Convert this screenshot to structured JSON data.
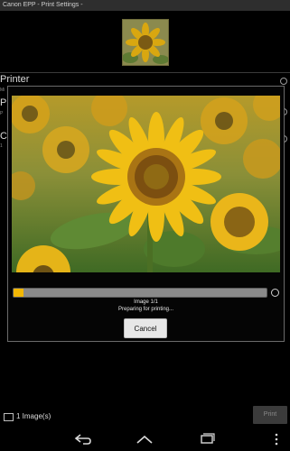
{
  "app": {
    "title": "Canon EPP  - Print Settings -"
  },
  "background": {
    "sections": [
      {
        "label": "Printer",
        "sub": "Mi"
      },
      {
        "label": "P",
        "sub": "P"
      },
      {
        "label": "C",
        "sub": "1"
      }
    ]
  },
  "dialog": {
    "image_counter": "Image 1/1",
    "status": "Preparing for printing...",
    "cancel_label": "Cancel",
    "progress": 0.04,
    "accent_color": "#f2b705"
  },
  "footer": {
    "image_count": "1 Image(s)",
    "print_label": "Print"
  },
  "navbar": {
    "icons": [
      "back-icon",
      "home-icon",
      "recent-apps-icon",
      "overflow-menu-icon"
    ]
  }
}
